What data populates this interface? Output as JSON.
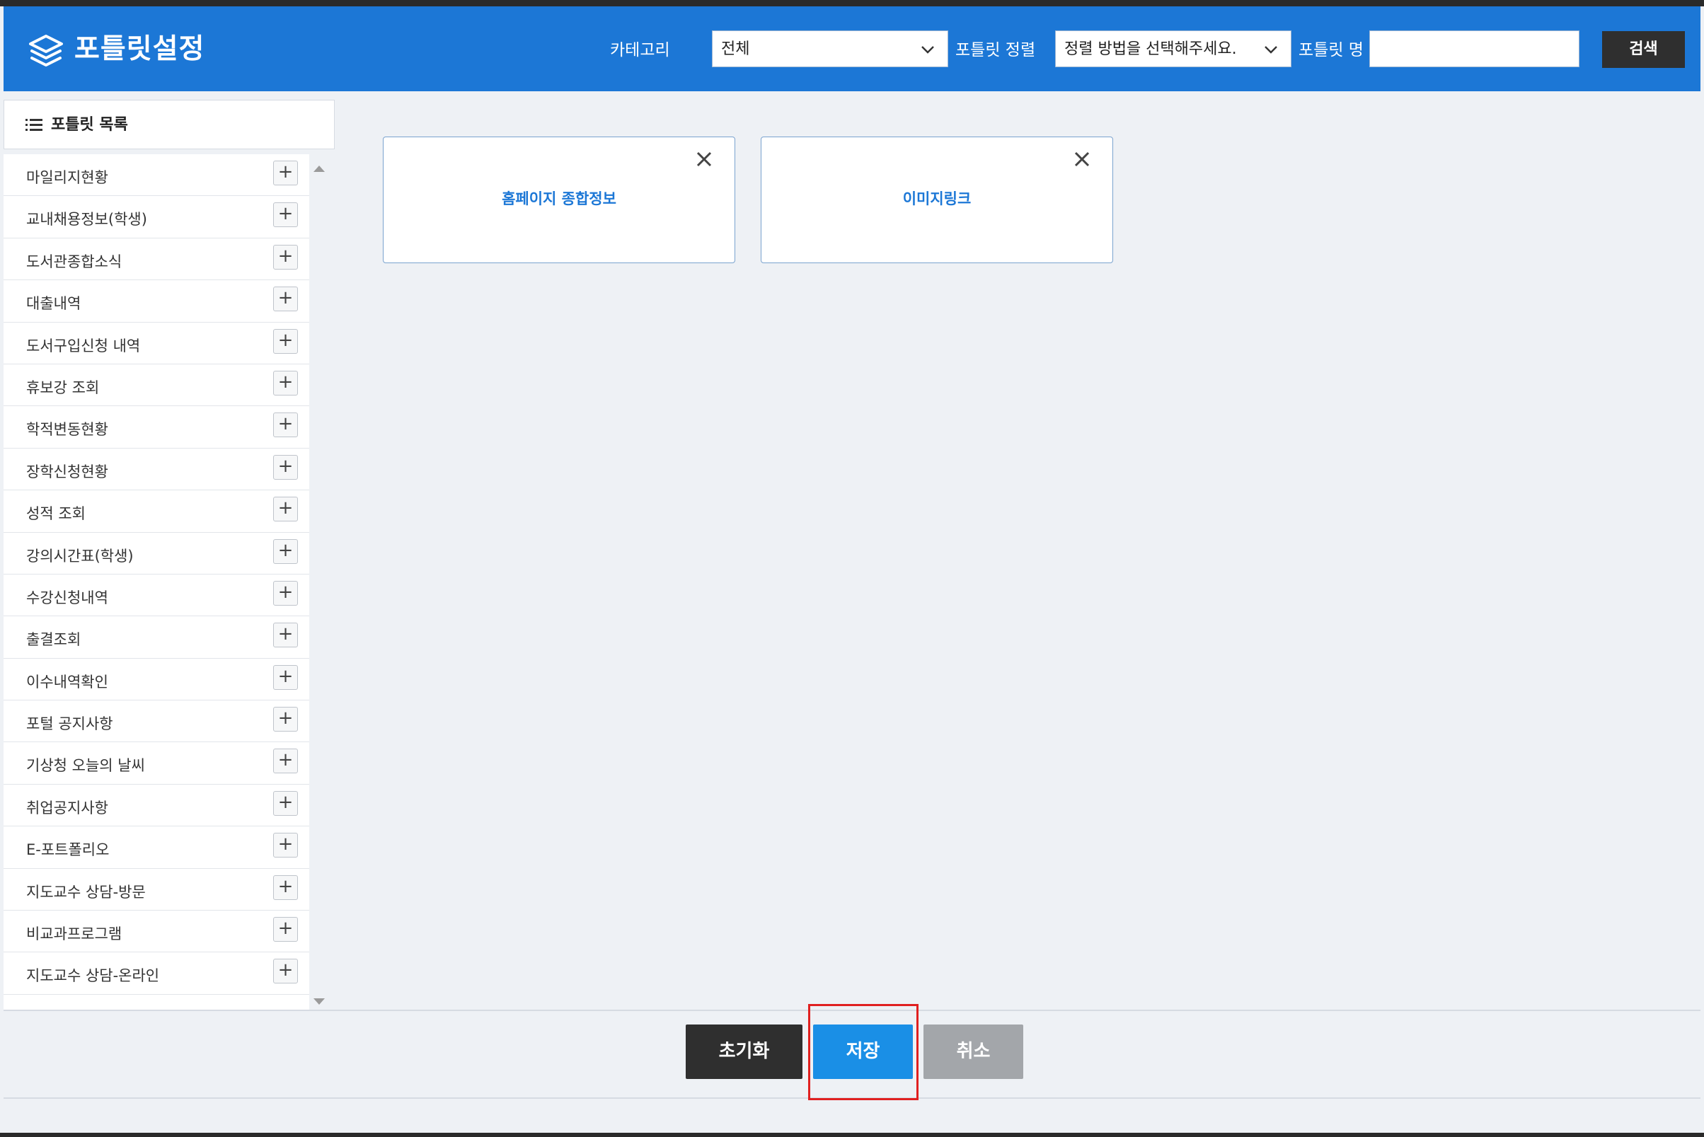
{
  "header": {
    "title": "포틀릿설정",
    "category_label": "카테고리",
    "category_value": "전체",
    "sort_label": "포틀릿 정렬",
    "sort_value": "정렬 방법을 선택해주세요.",
    "name_label": "포틀릿 명",
    "name_value": "",
    "search_label": "검색"
  },
  "sidebar": {
    "title": "포틀릿 목록",
    "items": [
      "마일리지현황",
      "교내채용정보(학생)",
      "도서관종합소식",
      "대출내역",
      "도서구입신청 내역",
      "휴보강 조회",
      "학적변동현황",
      "장학신청현황",
      "성적 조회",
      "강의시간표(학생)",
      "수강신청내역",
      "출결조회",
      "이수내역확인",
      "포털 공지사항",
      "기상청 오늘의 날씨",
      "취업공지사항",
      "E-포트폴리오",
      "지도교수 상담-방문",
      "비교과프로그램",
      "지도교수 상담-온라인"
    ],
    "add_glyph": "+"
  },
  "cards": [
    {
      "name": "홈페이지 종합정보"
    },
    {
      "name": "이미지링크"
    }
  ],
  "footer": {
    "reset_label": "초기화",
    "save_label": "저장",
    "cancel_label": "취소"
  },
  "colors": {
    "header_bg": "#1c77d6",
    "dark_button": "#2f2f2f",
    "save_button": "#1a8fe6",
    "cancel_button": "#a3a6aa",
    "highlight": "#e02020"
  }
}
